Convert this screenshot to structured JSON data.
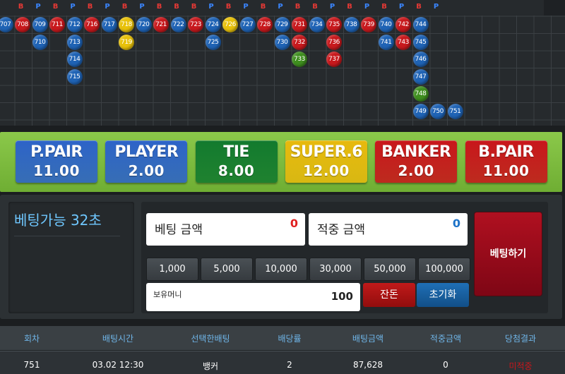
{
  "road": {
    "headers": [
      {
        "t": "B",
        "c": "#e53935"
      },
      {
        "t": "P",
        "c": "#3a86ff"
      },
      {
        "t": "B",
        "c": "#e53935"
      },
      {
        "t": "P",
        "c": "#3a86ff"
      },
      {
        "t": "B",
        "c": "#e53935"
      },
      {
        "t": "P",
        "c": "#3a86ff"
      },
      {
        "t": "B",
        "c": "#e53935"
      },
      {
        "t": "P",
        "c": "#3a86ff"
      },
      {
        "t": "B",
        "c": "#e53935"
      },
      {
        "t": "B",
        "c": "#e53935"
      },
      {
        "t": "B",
        "c": "#e53935"
      },
      {
        "t": "P",
        "c": "#3a86ff"
      },
      {
        "t": "B",
        "c": "#e53935"
      },
      {
        "t": "P",
        "c": "#3a86ff"
      },
      {
        "t": "B",
        "c": "#e53935"
      },
      {
        "t": "P",
        "c": "#3a86ff"
      },
      {
        "t": "B",
        "c": "#e53935"
      },
      {
        "t": "B",
        "c": "#e53935"
      },
      {
        "t": "P",
        "c": "#3a86ff"
      },
      {
        "t": "B",
        "c": "#e53935"
      },
      {
        "t": "P",
        "c": "#3a86ff"
      },
      {
        "t": "B",
        "c": "#e53935"
      },
      {
        "t": "P",
        "c": "#3a86ff"
      },
      {
        "t": "B",
        "c": "#e53935"
      },
      {
        "t": "P",
        "c": "#3a86ff"
      }
    ],
    "columns": [
      [
        {
          "n": "707",
          "k": "p"
        }
      ],
      [
        {
          "n": "708",
          "k": "b"
        }
      ],
      [
        {
          "n": "709",
          "k": "p"
        },
        {
          "n": "710",
          "k": "p"
        }
      ],
      [
        {
          "n": "711",
          "k": "b"
        }
      ],
      [
        {
          "n": "712",
          "k": "p"
        },
        {
          "n": "713",
          "k": "p"
        },
        {
          "n": "714",
          "k": "p"
        },
        {
          "n": "715",
          "k": "p"
        }
      ],
      [
        {
          "n": "716",
          "k": "b"
        }
      ],
      [
        {
          "n": "717",
          "k": "p"
        }
      ],
      [
        {
          "n": "718",
          "k": "t"
        },
        {
          "n": "719",
          "k": "t"
        }
      ],
      [
        {
          "n": "720",
          "k": "p"
        }
      ],
      [
        {
          "n": "721",
          "k": "b"
        }
      ],
      [
        {
          "n": "722",
          "k": "p"
        }
      ],
      [
        {
          "n": "723",
          "k": "b"
        }
      ],
      [
        {
          "n": "724",
          "k": "p"
        },
        {
          "n": "725",
          "k": "p"
        }
      ],
      [
        {
          "n": "726",
          "k": "t"
        }
      ],
      [
        {
          "n": "727",
          "k": "p"
        }
      ],
      [
        {
          "n": "728",
          "k": "b"
        }
      ],
      [
        {
          "n": "729",
          "k": "p"
        },
        {
          "n": "730",
          "k": "p"
        }
      ],
      [
        {
          "n": "731",
          "k": "b"
        },
        {
          "n": "732",
          "k": "b"
        },
        {
          "n": "733",
          "k": "g"
        }
      ],
      [
        {
          "n": "734",
          "k": "p"
        }
      ],
      [
        {
          "n": "735",
          "k": "b"
        },
        {
          "n": "736",
          "k": "b"
        },
        {
          "n": "737",
          "k": "b"
        }
      ],
      [
        {
          "n": "738",
          "k": "p"
        }
      ],
      [
        {
          "n": "739",
          "k": "b"
        }
      ],
      [
        {
          "n": "740",
          "k": "p"
        },
        {
          "n": "741",
          "k": "p"
        }
      ],
      [
        {
          "n": "742",
          "k": "b"
        },
        {
          "n": "743",
          "k": "b"
        }
      ],
      [
        {
          "n": "744",
          "k": "p"
        },
        {
          "n": "745",
          "k": "p"
        },
        {
          "n": "746",
          "k": "p"
        },
        {
          "n": "747",
          "k": "p"
        },
        {
          "n": "748",
          "k": "g"
        },
        {
          "n": "749",
          "k": "p"
        }
      ]
    ],
    "tail": [
      {
        "n": "750",
        "k": "p"
      },
      {
        "n": "751",
        "k": "p"
      }
    ],
    "colors": {
      "p": "#1f63b5",
      "b": "#c8191d",
      "t": "#e8c10a",
      "g": "#3f8f1f"
    }
  },
  "bets": [
    {
      "name": "P.PAIR",
      "odds": "11.00",
      "bg": "#2d63c8"
    },
    {
      "name": "PLAYER",
      "odds": "2.00",
      "bg": "#2d63c8"
    },
    {
      "name": "TIE",
      "odds": "8.00",
      "bg": "#127a2e"
    },
    {
      "name": "SUPER.6",
      "odds": "12.00",
      "bg": "#e7b90d"
    },
    {
      "name": "BANKER",
      "odds": "2.00",
      "bg": "#c8161b"
    },
    {
      "name": "B.PAIR",
      "odds": "11.00",
      "bg": "#c8161b"
    }
  ],
  "timer": {
    "text": "베팅가능 32초"
  },
  "bet_amount": {
    "label": "베팅 금액",
    "value": "0",
    "color": "#e02020"
  },
  "win_amount": {
    "label": "적중 금액",
    "value": "0",
    "color": "#1e73c8"
  },
  "chips": [
    "1,000",
    "5,000",
    "10,000",
    "30,000",
    "50,000",
    "100,000"
  ],
  "wallet": {
    "label": "보유머니",
    "value": "100"
  },
  "actions": {
    "change": "잔돈",
    "reset": "초기화",
    "bet": "베팅하기"
  },
  "table": {
    "headers": [
      "회차",
      "배팅시간",
      "선택한배팅",
      "배당률",
      "배팅금액",
      "적중금액",
      "당첨결과"
    ],
    "row": [
      "751",
      "03.02 12:30",
      "뱅커",
      "2",
      "87,628",
      "0",
      "미적중"
    ],
    "result_color": "#c8161b"
  }
}
